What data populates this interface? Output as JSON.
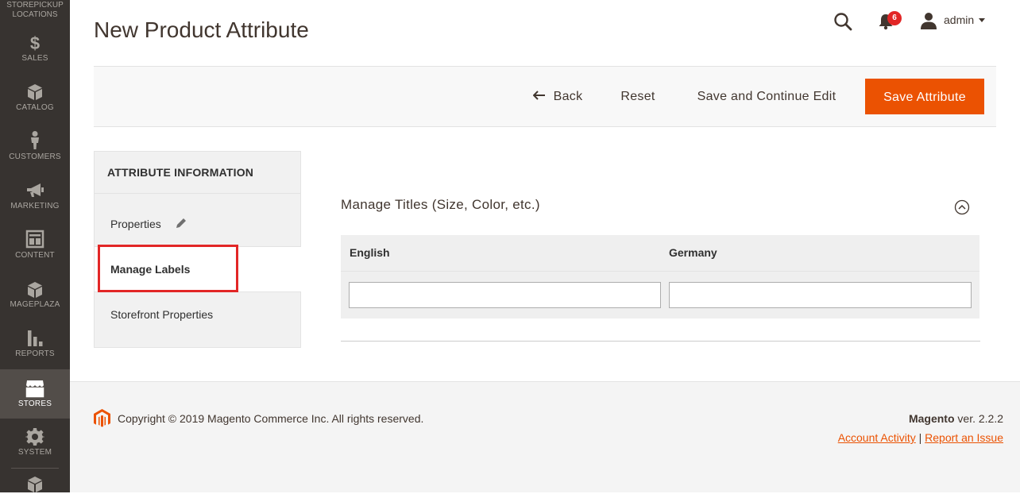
{
  "sidebar": {
    "top_label_line1": "STOREPICKUP",
    "top_label_line2": "LOCATIONS",
    "items": [
      {
        "label": "SALES",
        "icon": "dollar-icon"
      },
      {
        "label": "CATALOG",
        "icon": "box-icon"
      },
      {
        "label": "CUSTOMERS",
        "icon": "person-icon"
      },
      {
        "label": "MARKETING",
        "icon": "megaphone-icon"
      },
      {
        "label": "CONTENT",
        "icon": "layout-icon"
      },
      {
        "label": "MAGEPLAZA",
        "icon": "box-icon"
      },
      {
        "label": "REPORTS",
        "icon": "bar-chart-icon"
      },
      {
        "label": "STORES",
        "icon": "store-icon",
        "active": true
      },
      {
        "label": "SYSTEM",
        "icon": "gear-icon"
      }
    ]
  },
  "header": {
    "title": "New Product Attribute",
    "notifications_count": "6",
    "user_name": "admin"
  },
  "actions": {
    "back": "Back",
    "reset": "Reset",
    "save_continue": "Save and Continue Edit",
    "save": "Save Attribute"
  },
  "tabs": {
    "title": "ATTRIBUTE INFORMATION",
    "items": [
      {
        "label": "Properties"
      },
      {
        "label": "Manage Labels",
        "active": true
      },
      {
        "label": "Storefront Properties"
      }
    ]
  },
  "section": {
    "title": "Manage Titles (Size, Color, etc.)",
    "columns": [
      "English",
      "Germany"
    ],
    "values": [
      "",
      ""
    ]
  },
  "footer": {
    "copyright": "Copyright © 2019 Magento Commerce Inc. All rights reserved.",
    "brand": "Magento",
    "version": " ver. 2.2.2",
    "link_activity": "Account Activity",
    "link_separator": " | ",
    "link_issue": "Report an Issue"
  },
  "colors": {
    "accent": "#eb5202",
    "sidebar_bg": "#373330",
    "highlight": "#e22626"
  }
}
